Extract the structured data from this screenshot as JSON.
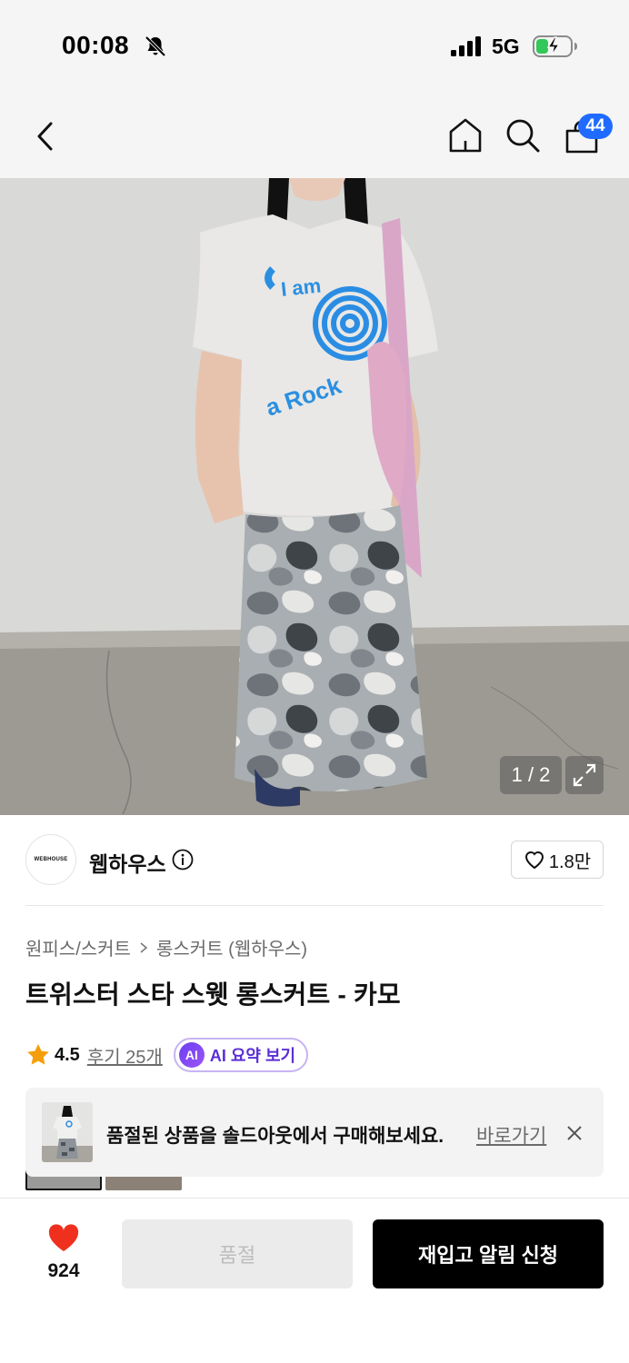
{
  "status_bar": {
    "time": "00:08",
    "network": "5G",
    "icons": [
      "bell-slash-icon",
      "signal-icon",
      "battery-charging-icon"
    ]
  },
  "nav": {
    "icons": [
      "back-icon",
      "home-icon",
      "search-icon",
      "cart-icon"
    ],
    "cart_count": "44"
  },
  "gallery": {
    "counter": "1 / 2",
    "expand_icon": "expand-icon"
  },
  "brand": {
    "logo_text": "WEBHOUSE",
    "name": "웹하우스",
    "info_icon": "info-icon",
    "like_count": "1.8만"
  },
  "product": {
    "breadcrumb": [
      "원피스/스커트",
      "롱스커트 (웹하우스)"
    ],
    "title": "트위스터 스타 스웻 롱스커트 - 카모",
    "rating": "4.5",
    "review_link": "후기 25개",
    "ai_badge": "AI",
    "ai_summary_label": "AI 요약 보기"
  },
  "banner": {
    "text": "품절된 상품을 솔드아웃에서 구매해보세요.",
    "link": "바로가기",
    "close_icon": "close-icon"
  },
  "bottom_bar": {
    "wish_count": "924",
    "soldout_label": "품절",
    "restock_label": "재입고 알림 신청"
  },
  "colors": {
    "cart_badge": "#1f6bff",
    "wish_heart": "#f0301e",
    "star": "#f59e0b",
    "ai_accent": "#6c3df2",
    "primary_button": "#000000"
  }
}
